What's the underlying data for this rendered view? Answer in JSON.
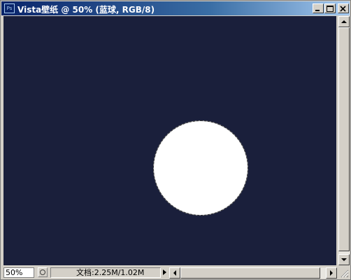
{
  "window": {
    "title": "Vista壁纸 @ 50% (蓝球, RGB/8)",
    "app_icon_text": "Ps"
  },
  "canvas": {
    "background_color": "#1a1f3b",
    "shape_color": "#ffffff"
  },
  "status": {
    "zoom": "50%",
    "doc_info": "文档:2.25M/1.02M"
  }
}
